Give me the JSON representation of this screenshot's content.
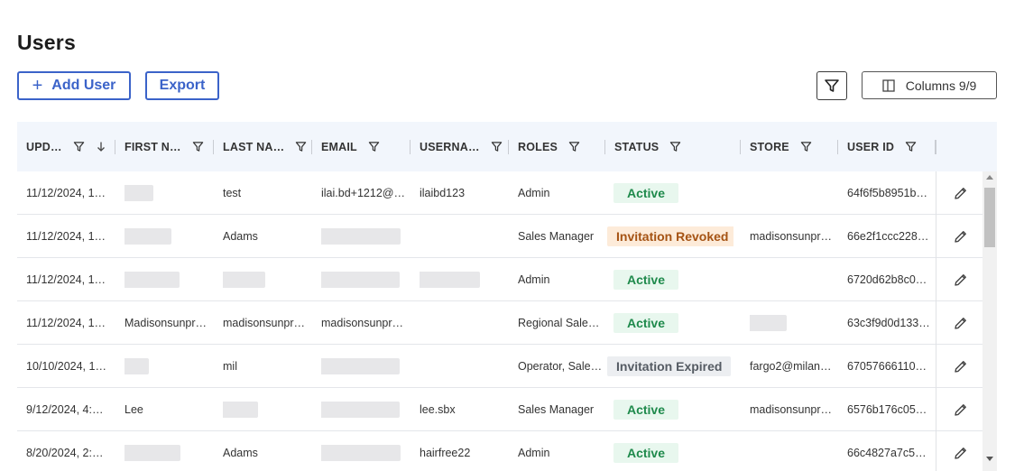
{
  "page": {
    "title": "Users"
  },
  "toolbar": {
    "add_user_label": "Add User",
    "export_label": "Export",
    "columns_label": "Columns 9/9",
    "add_icon": "plus-icon",
    "filter_icon": "filter-icon",
    "columns_icon": "columns-icon"
  },
  "colors": {
    "accent": "#3b63c9",
    "header_bg": "#f2f6fc",
    "active_bg": "#e8f7ee",
    "active_text": "#1f8a4c",
    "revoked_bg": "#fdebd9",
    "revoked_text": "#a55314",
    "expired_bg": "#eceef1",
    "expired_text": "#555b63"
  },
  "table": {
    "columns": [
      {
        "label": "UPD…",
        "icons": [
          "filter-icon",
          "sort-down-icon"
        ]
      },
      {
        "label": "FIRST N…",
        "icons": [
          "filter-icon"
        ]
      },
      {
        "label": "LAST NA…",
        "icons": [
          "filter-icon"
        ]
      },
      {
        "label": "EMAIL",
        "icons": [
          "filter-icon"
        ]
      },
      {
        "label": "USERNA…",
        "icons": [
          "filter-icon"
        ]
      },
      {
        "label": "ROLES",
        "icons": [
          "filter-icon"
        ]
      },
      {
        "label": "STATUS",
        "icons": [
          "filter-icon"
        ]
      },
      {
        "label": "STORE",
        "icons": [
          "filter-icon"
        ]
      },
      {
        "label": "USER ID",
        "icons": [
          "filter-icon"
        ]
      }
    ],
    "rows": [
      {
        "updated": "11/12/2024, 1…",
        "first": null,
        "last": "test",
        "email": "ilai.bd+1212@…",
        "username": "ilaibd123",
        "roles": "Admin",
        "status": "Active",
        "store": "",
        "user_id": "64f6f5b8951b…"
      },
      {
        "updated": "11/12/2024, 1…",
        "first": null,
        "last": "Adams",
        "email": null,
        "username": "",
        "roles": "Sales Manager",
        "status": "Invitation Revoked",
        "store": "madisonsunpr…",
        "user_id": "66e2f1ccc228…"
      },
      {
        "updated": "11/12/2024, 1…",
        "first": null,
        "last": null,
        "email": null,
        "username": null,
        "roles": "Admin",
        "status": "Active",
        "store": "",
        "user_id": "6720d62b8c0…"
      },
      {
        "updated": "11/12/2024, 1…",
        "first": "Madisonsunpr…",
        "last": "madisonsunpr…",
        "email": "madisonsunpr…",
        "username": "",
        "roles": "Regional Sale…",
        "status": "Active",
        "store": null,
        "user_id": "63c3f9d0d133…"
      },
      {
        "updated": "10/10/2024, 1…",
        "first": null,
        "last": "mil",
        "email": null,
        "username": "",
        "roles": "Operator, Sale…",
        "status": "Invitation Expired",
        "store": "fargo2@milan…",
        "user_id": "67057666110…"
      },
      {
        "updated": "9/12/2024, 4:…",
        "first": "Lee",
        "last": null,
        "email": null,
        "username": "lee.sbx",
        "roles": "Sales Manager",
        "status": "Active",
        "store": "madisonsunpr…",
        "user_id": "6576b176c05…"
      },
      {
        "updated": "8/20/2024, 2:…",
        "first": null,
        "last": "Adams",
        "email": null,
        "username": "hairfree22",
        "roles": "Admin",
        "status": "Active",
        "store": "",
        "user_id": "66c4827a7c5…"
      }
    ],
    "row_action_icon": "pencil-edit-icon"
  }
}
